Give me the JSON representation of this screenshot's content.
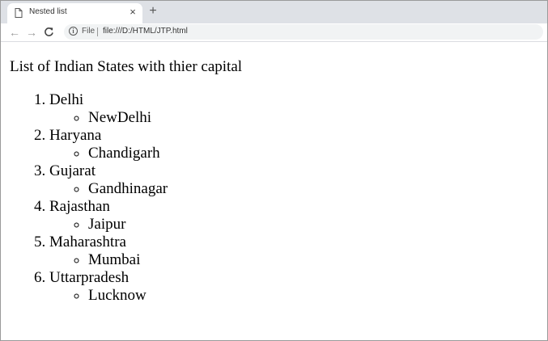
{
  "browser": {
    "tab_title": "Nested list",
    "tab_close_glyph": "×",
    "new_tab_glyph": "+",
    "back_glyph": "←",
    "forward_glyph": "→",
    "reload_glyph": "C",
    "info_glyph": "i",
    "url_scheme": "File",
    "url": "file:///D:/HTML/JTP.html"
  },
  "page": {
    "heading": "List of Indian States with thier capital",
    "states": [
      {
        "state": "Delhi",
        "capital": "NewDelhi"
      },
      {
        "state": "Haryana",
        "capital": "Chandigarh"
      },
      {
        "state": "Gujarat",
        "capital": "Gandhinagar"
      },
      {
        "state": "Rajasthan",
        "capital": "Jaipur"
      },
      {
        "state": "Maharashtra",
        "capital": "Mumbai"
      },
      {
        "state": "Uttarpradesh",
        "capital": "Lucknow"
      }
    ]
  }
}
